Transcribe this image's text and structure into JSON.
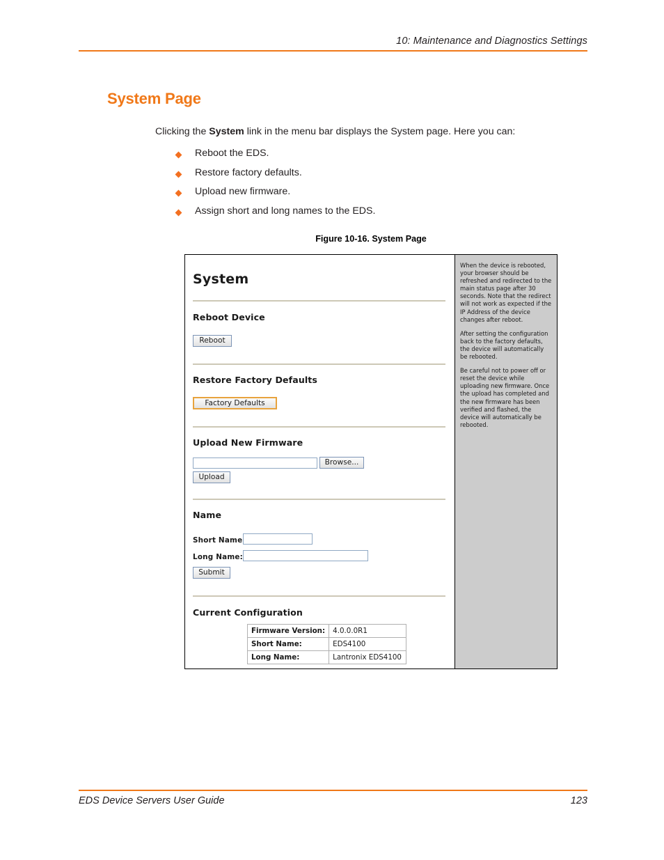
{
  "header": {
    "chapter": "10: Maintenance and Diagnostics Settings",
    "rule_color": "#F07818"
  },
  "section": {
    "title": "System Page",
    "title_color": "#F07818",
    "intro_prefix": "Clicking the ",
    "intro_bold": "System",
    "intro_suffix": " link in the menu bar displays the System page. Here you can:",
    "bullets": [
      "Reboot the EDS.",
      "Restore factory defaults.",
      "Upload new firmware.",
      "Assign short and long names to the EDS."
    ],
    "bullet_color": "#F37021"
  },
  "figure": {
    "caption": "Figure 10-16. System Page",
    "ui": {
      "page_title": "System",
      "sections": {
        "reboot": {
          "heading": "Reboot Device",
          "button": "Reboot"
        },
        "restore": {
          "heading": "Restore Factory Defaults",
          "button": "Factory Defaults",
          "button_border_color": "#e8a33d"
        },
        "upload": {
          "heading": "Upload New Firmware",
          "file_value": "",
          "browse_button": "Browse...",
          "upload_button": "Upload"
        },
        "name": {
          "heading": "Name",
          "short_label": "Short Name:",
          "short_value": "",
          "long_label": "Long Name:",
          "long_value": "",
          "submit_button": "Submit"
        },
        "current": {
          "heading": "Current Configuration",
          "rows": [
            {
              "key": "Firmware Version:",
              "value": "4.0.0.0R1"
            },
            {
              "key": "Short Name:",
              "value": "EDS4100"
            },
            {
              "key": "Long Name:",
              "value": "Lantronix EDS4100"
            }
          ]
        }
      },
      "help_panel": {
        "background": "#cccccc",
        "paragraphs": [
          "When the device is rebooted, your browser should be refreshed and redirected to the main status page after 30 seconds. Note that the redirect will not work as expected if the IP Address of the device changes after reboot.",
          "After setting the configuration back to the factory defaults, the device will automatically be rebooted.",
          "Be careful not to power off or reset the device while uploading new firmware. Once the upload has completed and the new firmware has been verified and flashed, the device will automatically be rebooted."
        ]
      }
    }
  },
  "footer": {
    "title": "EDS Device Servers User Guide",
    "page_number": "123"
  }
}
